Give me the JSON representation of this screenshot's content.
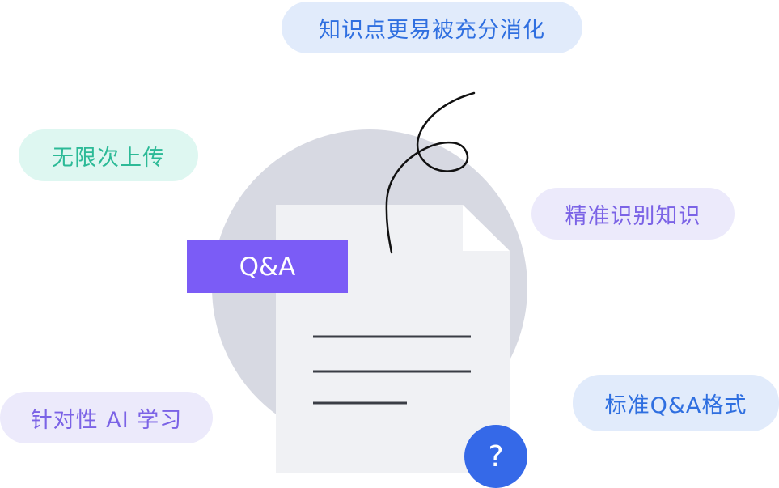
{
  "features": {
    "top": "知识点更易被充分消化",
    "left_upper": "无限次上传",
    "right_upper": "精准识别知识",
    "right_lower": "标准Q&A格式",
    "left_lower": "针对性 AI 学习"
  },
  "document": {
    "tag": "Q&A",
    "badge": "?"
  },
  "colors": {
    "blue": "#2f6fe0",
    "green": "#2cba97",
    "purple": "#7b63e6",
    "tag_purple": "#7b5cf6",
    "badge_blue": "#3569e8"
  },
  "icons": [
    "document-icon",
    "question-mark-icon",
    "scribble-decoration"
  ]
}
